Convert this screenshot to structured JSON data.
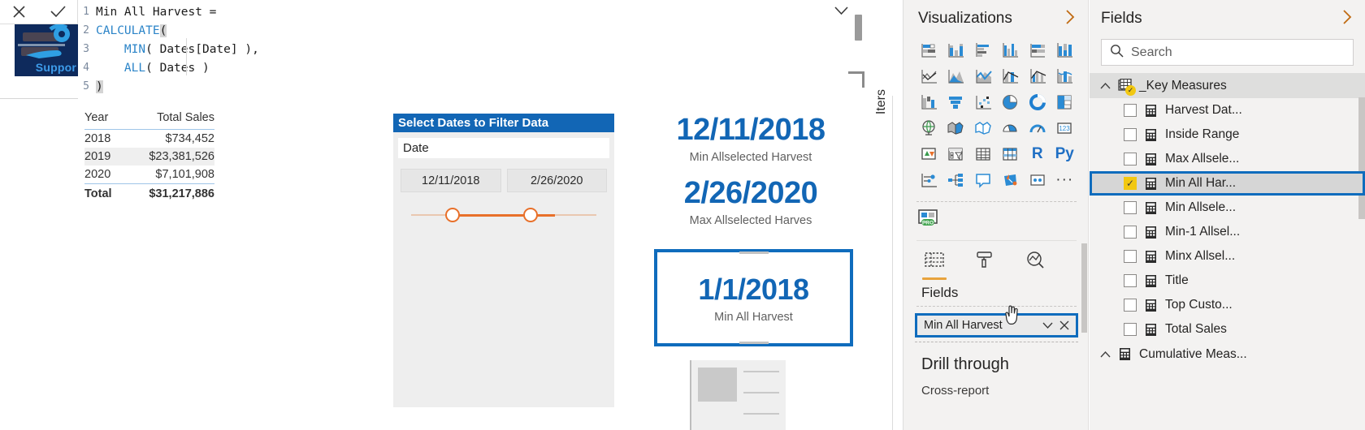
{
  "formula": {
    "measure_name": "Min All Harvest =",
    "lines": [
      {
        "n": "1",
        "text": "Min All Harvest ="
      },
      {
        "n": "2",
        "text": "CALCULATE("
      },
      {
        "n": "3",
        "text": "    MIN( Dates[Date] ),"
      },
      {
        "n": "4",
        "text": "    ALL( Dates )"
      },
      {
        "n": "5",
        "text": ")"
      }
    ],
    "cancel_icon": "close-icon",
    "commit_icon": "checkmark-icon",
    "logo_text": "Suppor"
  },
  "canvas": {
    "table": {
      "columns": [
        "Year",
        "Total Sales"
      ],
      "rows": [
        {
          "year": "2018",
          "sales": "$734,452"
        },
        {
          "year": "2019",
          "sales": "$23,381,526"
        },
        {
          "year": "2020",
          "sales": "$7,101,908"
        }
      ],
      "total_label": "Total",
      "total_value": "$31,217,886"
    },
    "slicer": {
      "title": "Select Dates to Filter Data",
      "field_label": "Date",
      "start_date": "12/11/2018",
      "end_date": "2/26/2020",
      "accent": "#e8702a",
      "header_bg": "#1266b5"
    },
    "cards": [
      {
        "value": "12/11/2018",
        "label": "Min Allselected Harvest"
      },
      {
        "value": "2/26/2020",
        "label": "Max Allselected Harves"
      }
    ],
    "selected_card": {
      "value": "1/1/2018",
      "label": "Min All Harvest"
    },
    "hover_icons": [
      "filter-icon",
      "more-options-icon"
    ]
  },
  "filters_rail": {
    "label": "Iters"
  },
  "visualizations": {
    "title": "Visualizations",
    "expand_icon": "chevron-right-icon",
    "icons": [
      "stacked-bar-chart-icon",
      "stacked-column-chart-icon",
      "clustered-bar-chart-icon",
      "clustered-column-chart-icon",
      "hundred-percent-stacked-bar-chart-icon",
      "hundred-percent-stacked-column-chart-icon",
      "line-chart-icon",
      "area-chart-icon",
      "stacked-area-chart-icon",
      "line-and-stacked-column-chart-icon",
      "line-and-clustered-column-chart-icon",
      "ribbon-chart-icon",
      "waterfall-chart-icon",
      "funnel-chart-icon",
      "scatter-chart-icon",
      "pie-chart-icon",
      "donut-chart-icon",
      "treemap-icon",
      "map-icon",
      "filled-map-icon",
      "shape-map-icon",
      "azure-map-icon",
      "gauge-chart-icon",
      "card-icon",
      "kpi-icon",
      "slicer-icon",
      "table-icon",
      "matrix-icon",
      "r-script-visual-icon",
      "python-visual-icon",
      "key-influencers-icon",
      "decomposition-tree-icon",
      "qna-icon",
      "smart-narrative-icon",
      "paginated-report-icon",
      "more-visuals-icon"
    ],
    "icon_text": {
      "r": "R",
      "py": "Py",
      "more": "···"
    },
    "pro_badge": "power-bi-pro-visual-icon",
    "format_tabs": [
      {
        "name": "fields-tab",
        "icon": "fields-pane-icon",
        "active": true
      },
      {
        "name": "format-tab",
        "icon": "paint-roller-icon",
        "active": false
      },
      {
        "name": "analytics-tab",
        "icon": "analytics-magnifier-icon",
        "active": false
      }
    ],
    "fields_section_title": "Fields",
    "field_well": {
      "value": "Min All Harvest",
      "dropdown_icon": "chevron-down-icon",
      "remove_icon": "close-icon"
    },
    "drill_through_title": "Drill through",
    "cross_report_label": "Cross-report"
  },
  "fields": {
    "title": "Fields",
    "expand_icon": "chevron-right-icon",
    "search_placeholder": "Search",
    "search_icon": "search-icon",
    "groups": [
      {
        "name": "_Key Measures",
        "expanded": true,
        "icon": "table-with-check-icon",
        "items": [
          {
            "label": "Harvest Dat...",
            "checked": false
          },
          {
            "label": "Inside Range",
            "checked": false
          },
          {
            "label": "Max Allsele...",
            "checked": false
          },
          {
            "label": "Min All Har...",
            "checked": true,
            "selected": true
          },
          {
            "label": "Min Allsele...",
            "checked": false
          },
          {
            "label": "Min-1 Allsel...",
            "checked": false
          },
          {
            "label": "Minx Allsel...",
            "checked": false
          },
          {
            "label": "Title",
            "checked": false
          },
          {
            "label": "Top Custo...",
            "checked": false
          },
          {
            "label": "Total Sales",
            "checked": false
          }
        ]
      },
      {
        "name": "Cumulative Meas...",
        "expanded": true,
        "icon": "measure-group-icon",
        "items": []
      }
    ]
  },
  "colors": {
    "accent_blue": "#1266b5",
    "selection_blue": "#0f6cbd",
    "highlight_yellow": "#f2c811",
    "slicer_orange": "#e8702a",
    "pane_bg": "#f3f2f1"
  }
}
